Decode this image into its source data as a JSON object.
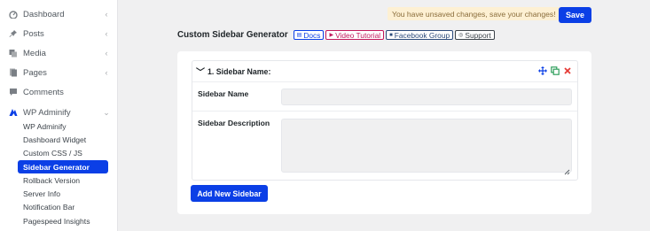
{
  "sidebar": {
    "items": [
      {
        "label": "Dashboard",
        "icon": "dashboard-icon"
      },
      {
        "label": "Posts",
        "icon": "pin-icon"
      },
      {
        "label": "Media",
        "icon": "media-icon"
      },
      {
        "label": "Pages",
        "icon": "pages-icon"
      },
      {
        "label": "Comments",
        "icon": "comment-icon"
      },
      {
        "label": "WP Adminify",
        "icon": "adminify-icon"
      }
    ],
    "submenu": [
      {
        "label": "WP Adminify"
      },
      {
        "label": "Dashboard Widget"
      },
      {
        "label": "Custom CSS / JS"
      },
      {
        "label": "Sidebar Generator",
        "current": true
      },
      {
        "label": "Rollback Version"
      },
      {
        "label": "Server Info"
      },
      {
        "label": "Notification Bar"
      },
      {
        "label": "Pagespeed Insights"
      }
    ]
  },
  "notice": "You have unsaved changes, save your changes!",
  "save_label": "Save",
  "header": {
    "title": "Custom Sidebar Generator",
    "docs": "Docs",
    "video": "Video Tutorial",
    "facebook": "Facebook Group",
    "support": "Support"
  },
  "repeater": {
    "item_title": "1. Sidebar Name:",
    "name_label": "Sidebar Name",
    "name_value": "",
    "desc_label": "Sidebar Description",
    "desc_value": ""
  },
  "add_button": "Add New Sidebar",
  "colors": {
    "accent": "#0b3fe6",
    "notice_bg": "#fdf0d3",
    "video": "#c2185b",
    "facebook": "#2b4a7a",
    "delete": "#e53935",
    "duplicate": "#2e9e5b"
  }
}
